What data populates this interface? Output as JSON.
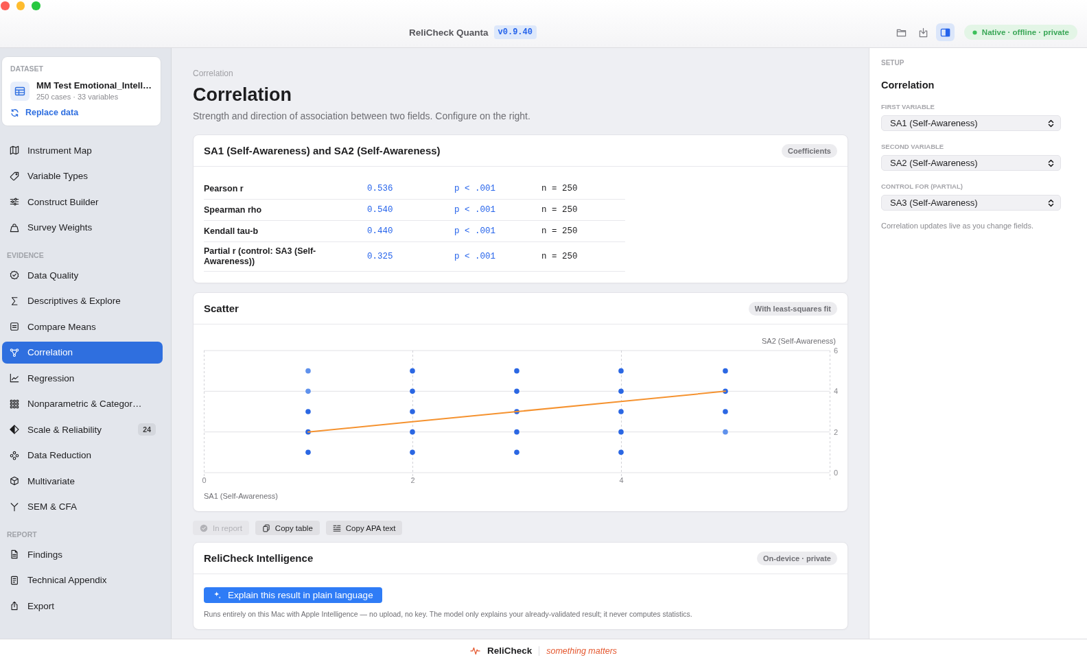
{
  "window": {
    "title": "ReliCheck Quanta",
    "version": "v0.9.40"
  },
  "toolbar": {
    "buttons": [
      {
        "selected": false
      },
      {
        "selected": false
      },
      {
        "selected": true
      }
    ],
    "status": "Native · offline · private"
  },
  "sidebar": {
    "dataset": {
      "heading": "DATASET",
      "name": "MM Test Emotional_Intell…",
      "meta": "250 cases · 33 variables",
      "action": "Replace data"
    },
    "sections": [
      {
        "items": [
          {
            "label": "Instrument Map",
            "selected": false
          },
          {
            "label": "Variable Types",
            "selected": false
          },
          {
            "label": "Construct Builder",
            "selected": false
          },
          {
            "label": "Survey Weights",
            "selected": false
          }
        ]
      },
      {
        "heading": "EVIDENCE",
        "items": [
          {
            "label": "Data Quality",
            "selected": false
          },
          {
            "label": "Descriptives & Explore",
            "selected": false
          },
          {
            "label": "Compare Means",
            "selected": false
          },
          {
            "label": "Correlation",
            "selected": true
          },
          {
            "label": "Regression",
            "selected": false
          },
          {
            "label": "Nonparametric & Categor…",
            "selected": false
          },
          {
            "label": "Scale & Reliability",
            "selected": false,
            "badge": "24"
          },
          {
            "label": "Data Reduction",
            "selected": false
          },
          {
            "label": "Multivariate",
            "selected": false
          },
          {
            "label": "SEM & CFA",
            "selected": false
          }
        ]
      },
      {
        "heading": "REPORT",
        "items": [
          {
            "label": "Findings",
            "selected": false
          },
          {
            "label": "Technical Appendix",
            "selected": false
          },
          {
            "label": "Export",
            "selected": false
          }
        ]
      }
    ]
  },
  "main": {
    "breadcrumb": "Correlation",
    "title": "Correlation",
    "subtitle": "Strength and direction of association between two fields. Configure on the right.",
    "coefficients": {
      "title": "SA1 (Self-Awareness) and SA2 (Self-Awareness)",
      "tag": "Coefficients",
      "rows": [
        {
          "label": "Pearson r",
          "value": "0.536",
          "p": "p < .001",
          "n": "n = 250"
        },
        {
          "label": "Spearman rho",
          "value": "0.540",
          "p": "p < .001",
          "n": "n = 250"
        },
        {
          "label": "Kendall tau-b",
          "value": "0.440",
          "p": "p < .001",
          "n": "n = 250"
        },
        {
          "label": "Partial r (control: SA3 (Self-Awareness))",
          "value": "0.325",
          "p": "p < .001",
          "n": "n = 250"
        }
      ]
    },
    "scatter": {
      "title": "Scatter",
      "tag": "With least-squares fit",
      "chart_data": {
        "type": "scatter",
        "xlabel": "SA1 (Self-Awareness)",
        "ylabel": "SA2 (Self-Awareness)",
        "xlim": [
          0,
          6
        ],
        "ylim": [
          0,
          6
        ],
        "xticks": [
          0,
          2,
          4
        ],
        "yticks": [
          0,
          2,
          4,
          6
        ],
        "grid": true,
        "x": [
          1,
          1,
          1,
          1,
          1,
          2,
          2,
          2,
          2,
          2,
          3,
          3,
          3,
          3,
          3,
          4,
          4,
          4,
          4,
          4,
          5,
          5,
          5,
          5
        ],
        "series": [
          {
            "type": "scatter",
            "color": "#2b67e3",
            "values": [
              null,
              null,
              3,
              2,
              1,
              5,
              4,
              3,
              2,
              1,
              5,
              4,
              3,
              2,
              1,
              5,
              4,
              3,
              2,
              1,
              5,
              4,
              3,
              null
            ]
          },
          {
            "type": "scatter",
            "color": "#5f91ec",
            "values": [
              5,
              4,
              null,
              null,
              null,
              null,
              null,
              null,
              null,
              null,
              null,
              null,
              null,
              null,
              null,
              null,
              null,
              null,
              null,
              null,
              null,
              null,
              null,
              2
            ]
          },
          {
            "type": "line",
            "color": "#f5922f",
            "values": [
              2,
              2,
              2,
              2,
              2,
              2.5,
              2.5,
              2.5,
              2.5,
              2.5,
              3,
              3,
              3,
              3,
              3,
              3.5,
              3.5,
              3.5,
              3.5,
              3.5,
              4,
              4,
              4,
              4
            ]
          }
        ]
      }
    },
    "actions": [
      {
        "label": "In report",
        "disabled": true
      },
      {
        "label": "Copy table",
        "disabled": false
      },
      {
        "label": "Copy APA text",
        "disabled": false
      }
    ],
    "intelligence": {
      "title": "ReliCheck Intelligence",
      "tag": "On-device · private",
      "button": "Explain this result in plain language",
      "note": "Runs entirely on this Mac with Apple Intelligence — no upload, no key. The model only explains your already-validated result; it never computes statistics."
    }
  },
  "setup": {
    "heading": "SETUP",
    "title": "Correlation",
    "fields": [
      {
        "label": "FIRST VARIABLE",
        "value": "SA1 (Self-Awareness)"
      },
      {
        "label": "SECOND VARIABLE",
        "value": "SA2 (Self-Awareness)"
      },
      {
        "label": "CONTROL FOR (PARTIAL)",
        "value": "SA3 (Self-Awareness)"
      }
    ],
    "note": "Correlation updates live as you change fields."
  },
  "footer": {
    "brand": "ReliCheck",
    "tagline": "something matters"
  }
}
